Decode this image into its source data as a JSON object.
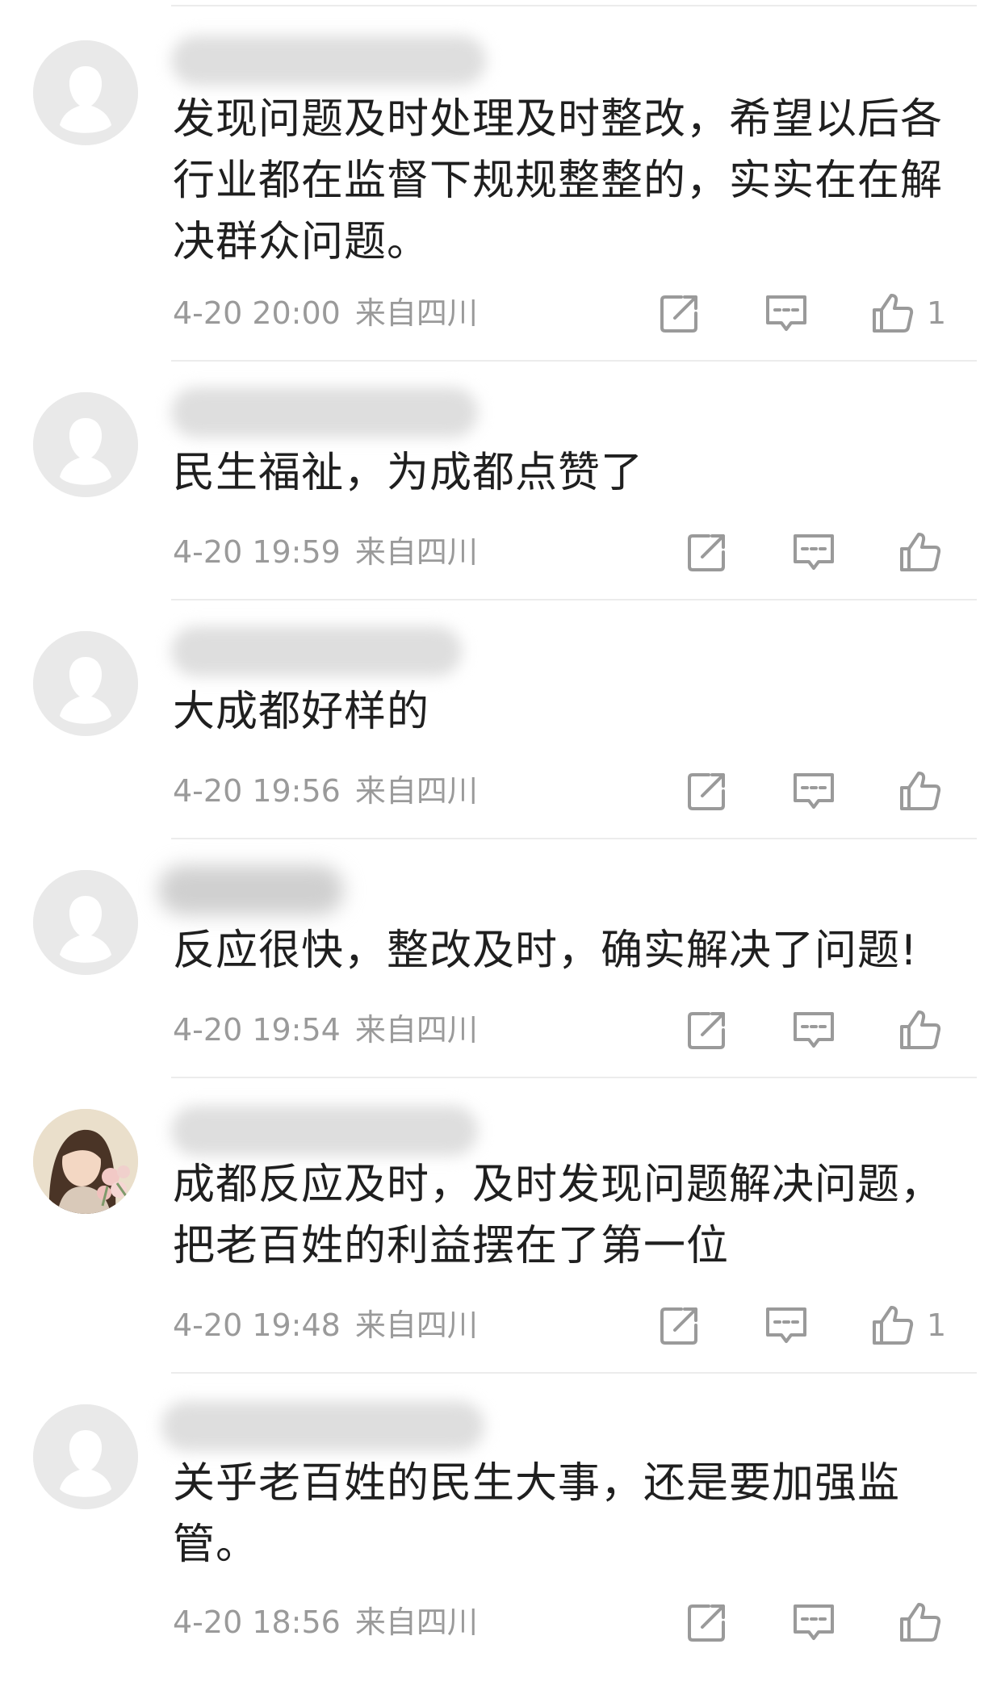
{
  "comments": [
    {
      "text": "发现问题及时处理及时整改，希望以后各行业都在监督下规规整整的，实实在在解决群众问题。",
      "time": "4-20 20:00",
      "location": "来自四川",
      "likes": "1",
      "avatar": "default-avatar-icon"
    },
    {
      "text": "民生福祉，为成都点赞了",
      "time": "4-20 19:59",
      "location": "来自四川",
      "likes": "",
      "avatar": "default-avatar-icon"
    },
    {
      "text": "大成都好样的",
      "time": "4-20 19:56",
      "location": "来自四川",
      "likes": "",
      "avatar": "default-avatar-icon"
    },
    {
      "text": "反应很快，整改及时，确实解决了问题!",
      "time": "4-20 19:54",
      "location": "来自四川",
      "likes": "",
      "avatar": "default-avatar-icon"
    },
    {
      "text": "成都反应及时，及时发现问题解决问题，把老百姓的利益摆在了第一位",
      "time": "4-20 19:48",
      "location": "来自四川",
      "likes": "1",
      "avatar": "user-photo"
    },
    {
      "text": "关乎老百姓的民生大事，还是要加强监管。",
      "time": "4-20 18:56",
      "location": "来自四川",
      "likes": "",
      "avatar": "default-avatar-icon"
    }
  ],
  "icons": {
    "share": "share-icon",
    "reply": "comment-icon",
    "like": "thumbs-up-icon"
  },
  "colors": {
    "text": "#1f1f1f",
    "meta": "#9a9a9a",
    "divider": "#ececec",
    "avatar_bg": "#e9e9e9"
  }
}
